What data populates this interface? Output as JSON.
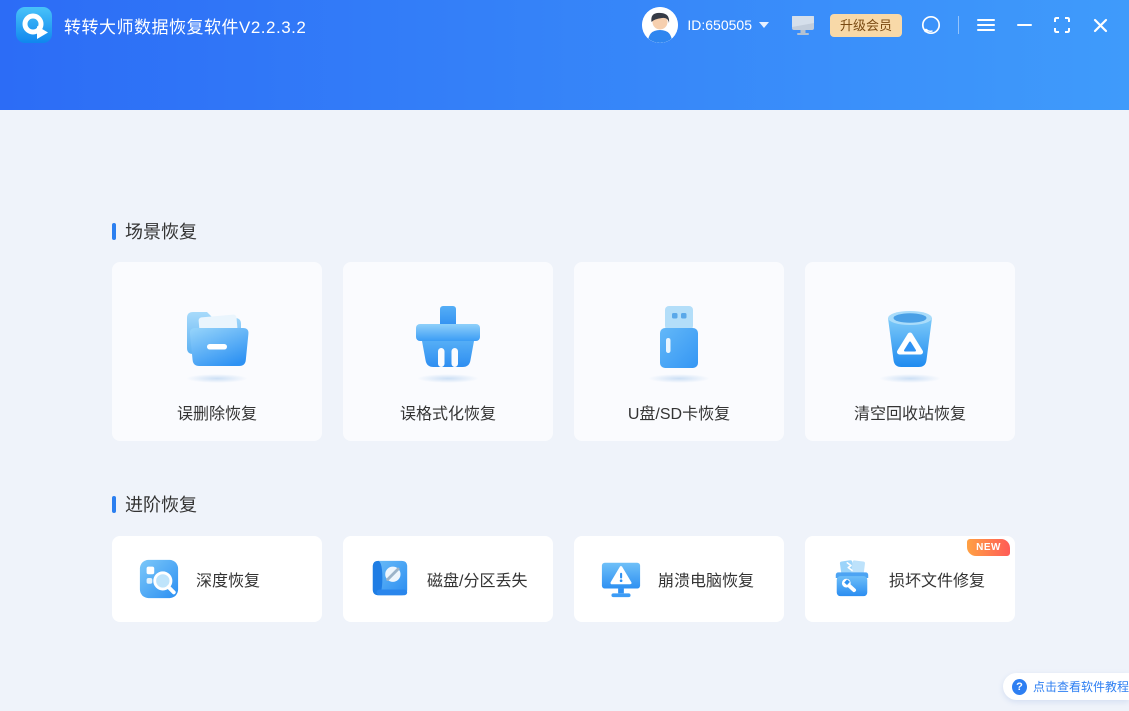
{
  "header": {
    "title": "转转大师数据恢复软件V2.2.3.2",
    "user_id": "ID:650505",
    "upgrade_label": "升级会员"
  },
  "sections": [
    {
      "title": "场景恢复",
      "cards": [
        {
          "label": "误删除恢复",
          "icon": "folder-icon"
        },
        {
          "label": "误格式化恢复",
          "icon": "format-brush-icon"
        },
        {
          "label": "U盘/SD卡恢复",
          "icon": "usb-drive-icon"
        },
        {
          "label": "清空回收站恢复",
          "icon": "recycle-bin-icon"
        }
      ]
    },
    {
      "title": "进阶恢复",
      "cards": [
        {
          "label": "深度恢复",
          "icon": "deep-scan-icon"
        },
        {
          "label": "磁盘/分区丢失",
          "icon": "disk-partition-icon"
        },
        {
          "label": "崩溃电脑恢复",
          "icon": "crashed-pc-icon"
        },
        {
          "label": "损坏文件修复",
          "icon": "file-repair-icon",
          "badge": "NEW"
        }
      ]
    }
  ],
  "tutorial_button": {
    "label": "点击查看软件教程",
    "icon_glyph": "?"
  },
  "colors": {
    "header_gradient_start": "#2c6cf6",
    "header_gradient_end": "#3f9bfb",
    "content_bg": "#eff3fa",
    "accent_blue": "#2b7ff0",
    "card_bg_big": "#fafbfe",
    "card_bg_small": "#ffffff",
    "text_dark": "#333333",
    "upgrade_bg": "#f8d9a8",
    "upgrade_text": "#7a4a12",
    "new_badge_start": "#ffa143",
    "new_badge_end": "#ff5b57"
  }
}
